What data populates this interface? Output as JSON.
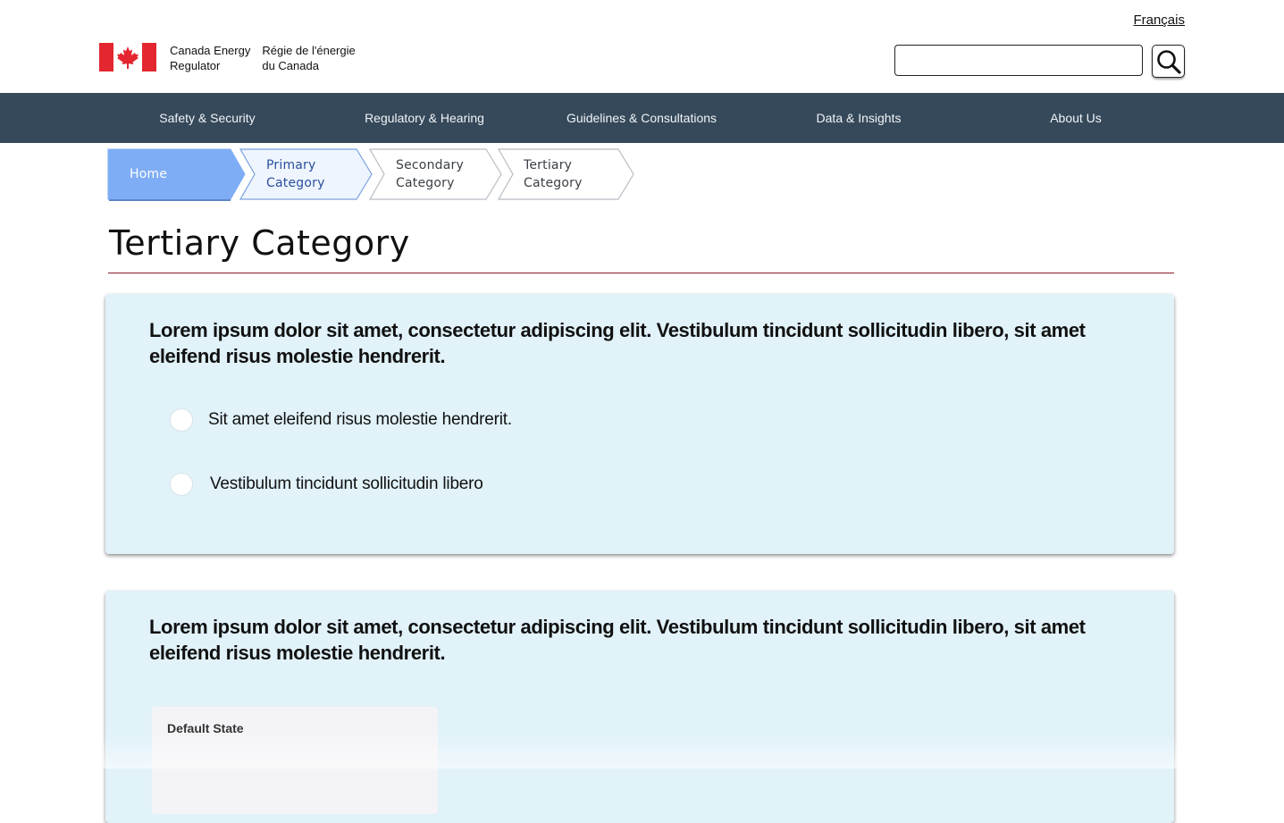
{
  "header": {
    "language_link": "Français",
    "brand_en_line1": "Canada Energy",
    "brand_en_line2": "Regulator",
    "brand_fr_line1": "Régie de l'énergie",
    "brand_fr_line2": "du Canada",
    "flag_icon": "canada-flag-icon",
    "search": {
      "value": "",
      "placeholder": "",
      "button_icon": "search-icon"
    }
  },
  "nav": {
    "items": [
      {
        "label": "Safety & Security"
      },
      {
        "label": "Regulatory & Hearing"
      },
      {
        "label": "Guidelines & Consultations"
      },
      {
        "label": "Data & Insights"
      },
      {
        "label": "About Us"
      }
    ]
  },
  "breadcrumb": {
    "items": [
      {
        "line1": "Home",
        "line2": "",
        "state": "active"
      },
      {
        "line1": "Primary",
        "line2": "Category",
        "state": "visited"
      },
      {
        "line1": "Secondary",
        "line2": "Category",
        "state": "default"
      },
      {
        "line1": "Tertiary",
        "line2": "Category",
        "state": "default"
      }
    ]
  },
  "page": {
    "title": "Tertiary Category"
  },
  "cards": [
    {
      "question": "Lorem ipsum dolor sit amet, consectetur adipiscing elit. Vestibulum tincidunt sollicitudin libero, sit amet eleifend risus molestie hendrerit.",
      "options": [
        {
          "label": "Sit amet eleifend risus molestie hendrerit.",
          "selected": false
        },
        {
          "label": "Vestibulum tincidunt sollicitudin libero",
          "selected": false
        }
      ]
    },
    {
      "question": "Lorem ipsum dolor sit amet, consectetur adipiscing elit. Vestibulum tincidunt sollicitudin libero, sit amet eleifend risus molestie hendrerit.",
      "state_label": "Default State"
    }
  ],
  "colors": {
    "nav_bg": "#35495a",
    "card_bg": "#e1f2f9",
    "crumb_active": "#7eadf5",
    "crumb_visited": "#eef5ff",
    "title_rule": "#8a1c2b"
  }
}
